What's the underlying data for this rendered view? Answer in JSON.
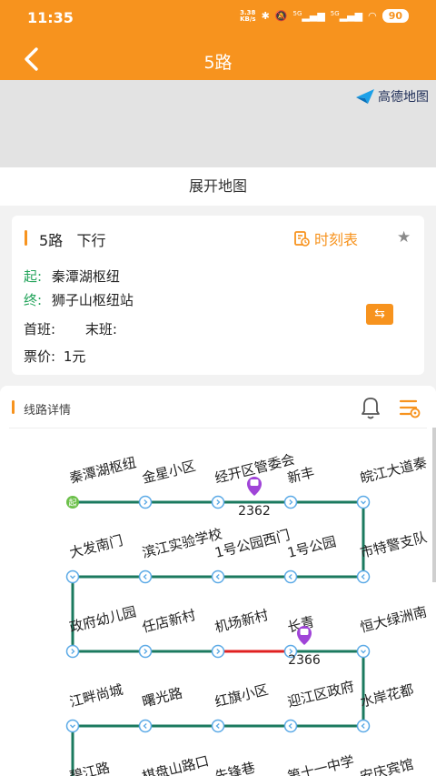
{
  "status": {
    "time": "11:35",
    "net_speed": "3.38\nKB/s",
    "signal1": "5G",
    "signal2": "5G",
    "battery": "90"
  },
  "header": {
    "title": "5路"
  },
  "map": {
    "logo_text": "高德地图",
    "expand_label": "展开地图"
  },
  "route": {
    "name": "5路",
    "direction": "下行",
    "timetable_label": "时刻表",
    "start_label": "起:",
    "start": "秦潭湖枢纽",
    "end_label": "终:",
    "end": "狮子山枢纽站",
    "first_label": "首班:",
    "last_label": "末班:",
    "fare_label": "票价:",
    "fare": "1元"
  },
  "detail": {
    "title": "线路详情",
    "start_badge": "起"
  },
  "stations": [
    "秦潭湖枢纽",
    "金星小区",
    "经开区管委会",
    "新丰",
    "皖江大道秦",
    "市特警支队",
    "1号公园",
    "1号公园西门",
    "滨江实验学校",
    "大发南门",
    "政府幼儿园",
    "任店新村",
    "机场新村",
    "长青",
    "恒大绿洲南",
    "水岸花都",
    "迎江区政府",
    "红旗小区",
    "曙光路",
    "江畔尚城",
    "碧江路",
    "棋盘山路口",
    "先锋巷",
    "第十一中学",
    "安庆宾馆"
  ],
  "buses": [
    {
      "plate": "2362"
    },
    {
      "plate": "2366"
    }
  ],
  "colors": {
    "accent": "#f7931e",
    "line": "#1b7a5f",
    "congested": "#e02020",
    "station": "#5aa9e6",
    "bus": "#a044d8"
  }
}
